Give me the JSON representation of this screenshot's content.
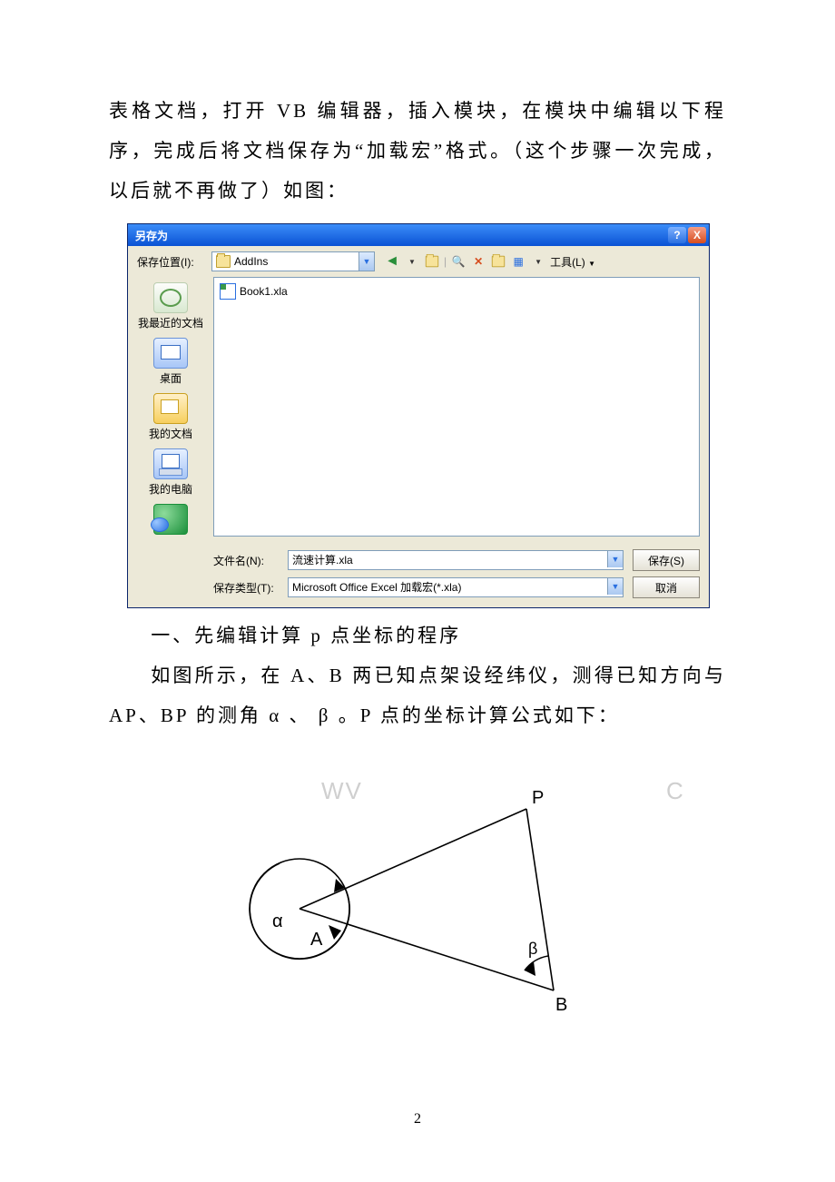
{
  "paragraphs": {
    "p1": "表格文档，打开 VB 编辑器，插入模块，在模块中编辑以下程序，完成后将文档保存为“加载宏”格式。（这个步骤一次完成，以后就不再做了）如图：",
    "p2": "一、先编辑计算 p 点坐标的程序",
    "p3": "如图所示，在 A、B 两已知点架设经纬仪，测得已知方向与 AP、BP 的测角 α 、 β 。P 点的坐标计算公式如下："
  },
  "dialog": {
    "title": "另存为",
    "help": "?",
    "close": "X",
    "locLabel": "保存位置(I):",
    "folderName": "AddIns",
    "toolsLabel": "工具(L)",
    "fileItem": "Book1.xla",
    "places": {
      "recent": "我最近的文档",
      "desktop": "桌面",
      "docs": "我的文档",
      "pc": "我的电脑"
    },
    "fileNameLabel": "文件名(N):",
    "fileNameValue": "流速计算.xla",
    "fileTypeLabel": "保存类型(T):",
    "fileTypeValue": "Microsoft Office Excel 加载宏(*.xla)",
    "saveBtn": "保存(S)",
    "cancelBtn": "取消"
  },
  "diagram": {
    "A": "A",
    "B": "B",
    "P": "P",
    "alpha": "α",
    "beta": "β"
  },
  "watermark": {
    "left": "WV",
    "right": "C"
  },
  "pageNumber": "2"
}
